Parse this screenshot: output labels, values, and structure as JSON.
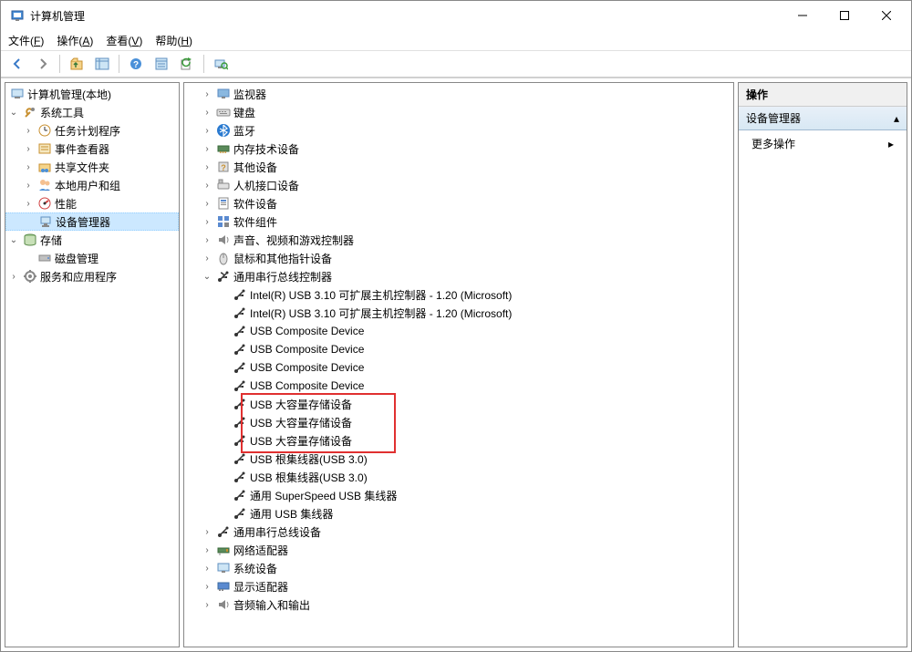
{
  "window": {
    "title": "计算机管理"
  },
  "menu": {
    "file": "文件(F)",
    "action": "操作(A)",
    "view": "查看(V)",
    "help": "帮助(H)"
  },
  "leftTree": {
    "root": "计算机管理(本地)",
    "systemTools": "系统工具",
    "taskScheduler": "任务计划程序",
    "eventViewer": "事件查看器",
    "sharedFolders": "共享文件夹",
    "localUsers": "本地用户和组",
    "performance": "性能",
    "deviceManager": "设备管理器",
    "storage": "存储",
    "diskMgmt": "磁盘管理",
    "services": "服务和应用程序"
  },
  "centerTree": {
    "monitor": "监视器",
    "keyboard": "键盘",
    "bluetooth": "蓝牙",
    "memory": "内存技术设备",
    "other": "其他设备",
    "hid": "人机接口设备",
    "software": "软件设备",
    "swComponents": "软件组件",
    "sound": "声音、视频和游戏控制器",
    "mouse": "鼠标和其他指针设备",
    "usbController": "通用串行总线控制器",
    "usbDevices": "通用串行总线设备",
    "network": "网络适配器",
    "system": "系统设备",
    "display": "显示适配器",
    "audio": "音频输入和输出",
    "intelUsb1": "Intel(R) USB 3.10 可扩展主机控制器 - 1.20 (Microsoft)",
    "intelUsb2": "Intel(R) USB 3.10 可扩展主机控制器 - 1.20 (Microsoft)",
    "usbComp1": "USB Composite Device",
    "usbComp2": "USB Composite Device",
    "usbComp3": "USB Composite Device",
    "usbComp4": "USB Composite Device",
    "usbMass1": "USB 大容量存储设备",
    "usbMass2": "USB 大容量存储设备",
    "usbMass3": "USB 大容量存储设备",
    "usbRoot1": "USB 根集线器(USB 3.0)",
    "usbRoot2": "USB 根集线器(USB 3.0)",
    "usbSuper": "通用 SuperSpeed USB 集线器",
    "usbHub": "通用 USB 集线器"
  },
  "right": {
    "header": "操作",
    "section": "设备管理器",
    "more": "更多操作"
  }
}
